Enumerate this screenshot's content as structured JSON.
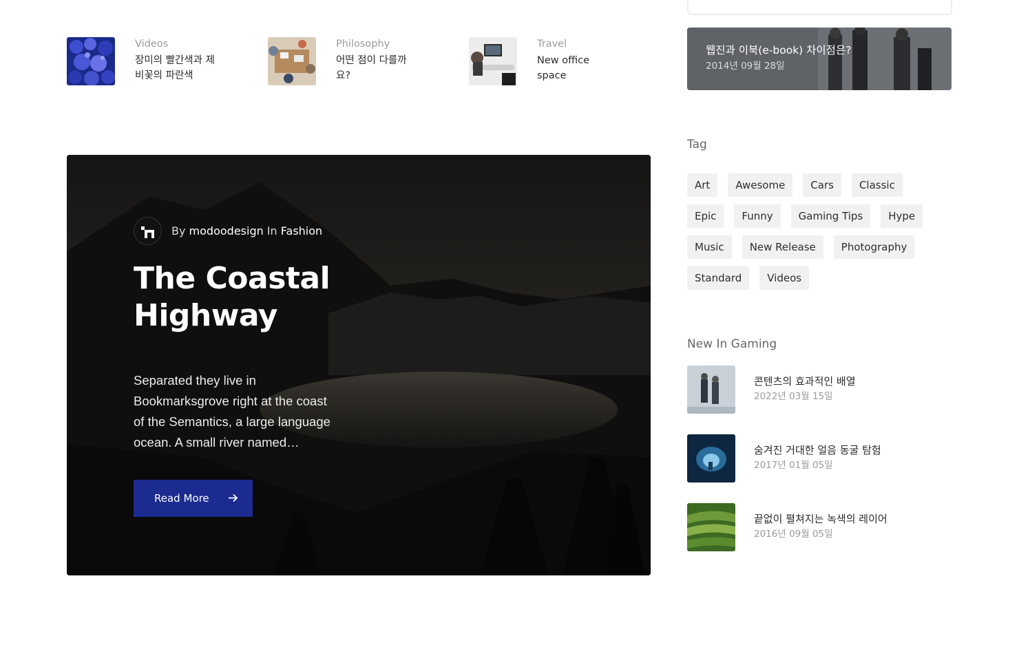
{
  "category_posts": [
    {
      "label": "Videos",
      "title": "장미의 빨간색과 제비꽃의 파란색",
      "thumb_icon": "hydrangea-photo"
    },
    {
      "label": "Philosophy",
      "title": "어떤 점이 다를까요?",
      "thumb_icon": "meeting-table-photo"
    },
    {
      "label": "Travel",
      "title": "New office space",
      "thumb_icon": "office-desk-photo"
    }
  ],
  "hero": {
    "by_label": "By",
    "author": "modoodesign",
    "in_label": "In",
    "category": "Fashion",
    "title": "The Coastal Highway",
    "excerpt": "Separated they live in Bookmarksgrove right at the coast of the Semantics, a large language ocean. A small river named…",
    "button_label": "Read More",
    "button_color": "#1c2b8f"
  },
  "sidebar": {
    "feature": {
      "title": "웹진과 이북(e-book) 차이점은?",
      "date": "2014년 09월 28일"
    },
    "tag_heading": "Tag",
    "tags": [
      [
        "Art",
        "Awesome",
        "Cars",
        "Classic"
      ],
      [
        "Epic",
        "Funny",
        "Gaming Tips",
        "Hype"
      ],
      [
        "Music",
        "New Release",
        "Photography"
      ],
      [
        "Standard",
        "Videos"
      ]
    ],
    "gaming_heading": "New In Gaming",
    "gaming_posts": [
      {
        "title": "콘텐츠의 효과적인 배열",
        "date": "2022년 03월 15일",
        "thumb_icon": "business-people-photo"
      },
      {
        "title": "숨겨진 거대한 얼음 동굴 탐험",
        "date": "2017년 01월 05일",
        "thumb_icon": "ice-cave-photo"
      },
      {
        "title": "끝없이 펼쳐지는 녹색의 레이어",
        "date": "2016년 09월 05일",
        "thumb_icon": "green-terraces-photo"
      }
    ]
  }
}
